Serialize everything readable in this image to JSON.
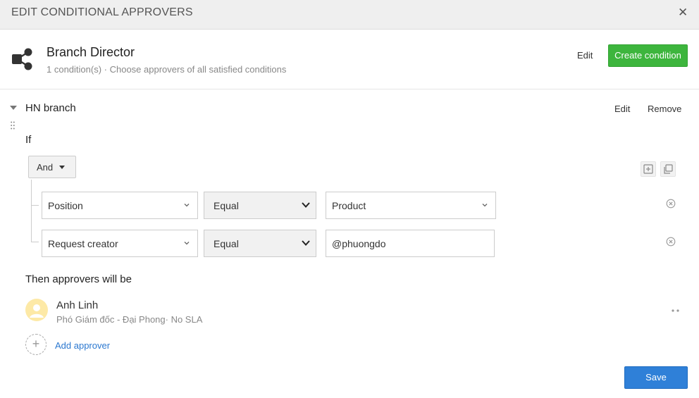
{
  "dialog": {
    "title": "EDIT CONDITIONAL APPROVERS",
    "close_glyph": "✕"
  },
  "header": {
    "icon": "share-icon",
    "name": "Branch Director",
    "subtitle": "1 condition(s) · Choose approvers of all satisfied conditions",
    "edit_label": "Edit",
    "create_label": "Create condition",
    "create_color": "#3db53d"
  },
  "condition": {
    "name": "HN branch",
    "edit_label": "Edit",
    "remove_label": "Remove",
    "if_label": "If",
    "operator": "And",
    "rules": [
      {
        "field": "Position",
        "comparator": "Equal",
        "value": "Product",
        "value_is_select": true
      },
      {
        "field": "Request creator",
        "comparator": "Equal",
        "value": "@phuongdo",
        "value_is_select": false
      }
    ]
  },
  "approvers": {
    "label": "Then approvers will be",
    "items": [
      {
        "name": "Anh Linh",
        "detail": "Phó Giám đốc - Đại Phong· No SLA"
      }
    ],
    "add_label": "Add approver",
    "add_glyph": "+"
  },
  "footer": {
    "save_label": "Save",
    "save_color": "#2f80d8"
  }
}
